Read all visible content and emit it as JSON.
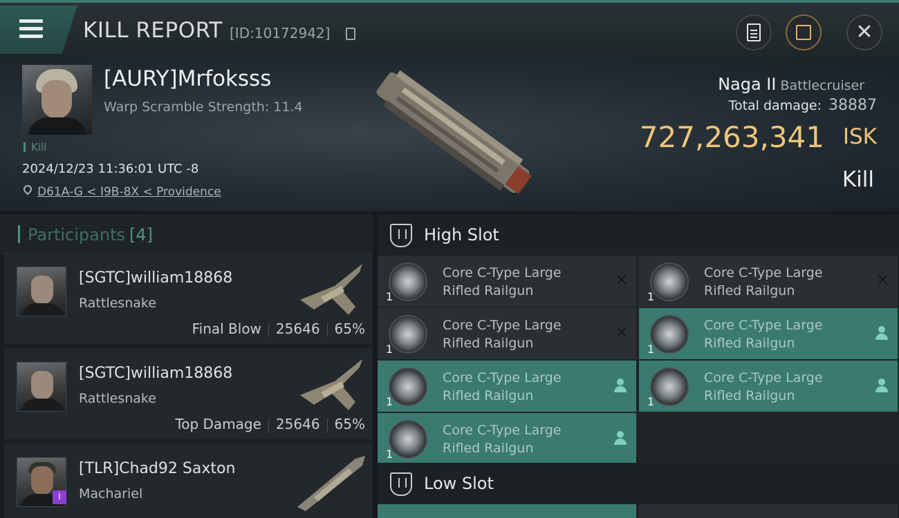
{
  "header": {
    "title": "KILL REPORT",
    "report_id": "[ID:10172942]"
  },
  "victim": {
    "name": "[AURY]Mrfoksss",
    "warp_scramble": "Warp Scramble Strength: 11.4",
    "tag": "Kill",
    "timestamp": "2024/12/23 11:36:01 UTC -8",
    "location": "D61A-G < I9B-8X < Providence",
    "ship_name": "Naga II",
    "ship_class": "Battlecruiser",
    "total_damage_label": "Total damage:",
    "total_damage_value": "38887",
    "isk_value": "727,263,341",
    "isk_unit": "ISK",
    "result": "Kill"
  },
  "participants": {
    "title": "Participants",
    "count": "[4]",
    "rows": [
      {
        "name": "[SGTC]william18868",
        "ship": "Rattlesnake",
        "label": "Final Blow",
        "damage": "25646",
        "percent": "65%"
      },
      {
        "name": "[SGTC]william18868",
        "ship": "Rattlesnake",
        "label": "Top Damage",
        "damage": "25646",
        "percent": "65%"
      },
      {
        "name": "[TLR]Chad92 Saxton",
        "ship": "Machariel",
        "label": "",
        "damage": "",
        "percent": ""
      }
    ]
  },
  "fittings": {
    "high_slot_title": "High Slot",
    "low_slot_title": "Low Slot",
    "modules": [
      {
        "line1": "Core C-Type Large",
        "line2": "Rifled Railgun",
        "qty": "1",
        "state": "destroyed"
      },
      {
        "line1": "Core C-Type Large",
        "line2": "Rifled Railgun",
        "qty": "1",
        "state": "destroyed"
      },
      {
        "line1": "Core C-Type Large",
        "line2": "Rifled Railgun",
        "qty": "1",
        "state": "destroyed"
      },
      {
        "line1": "Core C-Type Large",
        "line2": "Rifled Railgun",
        "qty": "1",
        "state": "dropped"
      },
      {
        "line1": "Core C-Type Large",
        "line2": "Rifled Railgun",
        "qty": "1",
        "state": "dropped"
      },
      {
        "line1": "Core C-Type Large",
        "line2": "Rifled Railgun",
        "qty": "1",
        "state": "dropped"
      },
      {
        "line1": "Core C-Type Large",
        "line2": "Rifled Railgun",
        "qty": "1",
        "state": "dropped"
      }
    ]
  },
  "icons": {
    "menu": "menu-icon",
    "copy": "copy-icon",
    "clipboard": "clipboard-icon",
    "share": "share-icon",
    "close": "close-icon",
    "location": "location-pin-icon",
    "slot": "slot-icon",
    "pilot": "pilot-icon",
    "destroyed": "x-icon"
  },
  "colors": {
    "accent": "#3b7a71",
    "isk": "#f0c579",
    "share": "#e8b25b"
  }
}
